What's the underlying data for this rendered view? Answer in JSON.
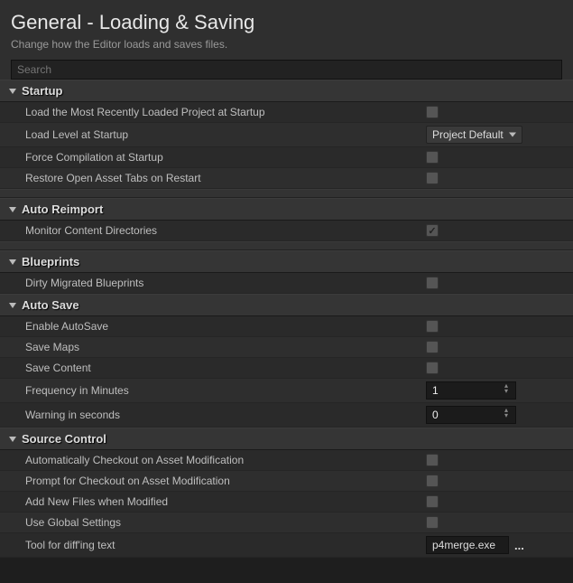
{
  "header": {
    "title": "General - Loading & Saving",
    "subtitle": "Change how the Editor loads and saves files."
  },
  "search": {
    "placeholder": "Search",
    "value": ""
  },
  "sections": {
    "startup": {
      "title": "Startup",
      "load_recent": "Load the Most Recently Loaded Project at Startup",
      "load_level": "Load Level at Startup",
      "load_level_value": "Project Default",
      "force_compile": "Force Compilation at Startup",
      "restore_tabs": "Restore Open Asset Tabs on Restart"
    },
    "auto_reimport": {
      "title": "Auto Reimport",
      "monitor": "Monitor Content Directories"
    },
    "blueprints": {
      "title": "Blueprints",
      "dirty": "Dirty Migrated Blueprints"
    },
    "auto_save": {
      "title": "Auto Save",
      "enable": "Enable AutoSave",
      "save_maps": "Save Maps",
      "save_content": "Save Content",
      "freq": "Frequency in Minutes",
      "freq_val": "1",
      "warn": "Warning in seconds",
      "warn_val": "0"
    },
    "source_control": {
      "title": "Source Control",
      "auto_checkout": "Automatically Checkout on Asset Modification",
      "prompt_checkout": "Prompt for Checkout on Asset Modification",
      "add_new": "Add New Files when Modified",
      "global": "Use Global Settings",
      "diff_tool": "Tool for diff'ing text",
      "diff_tool_val": "p4merge.exe"
    }
  }
}
